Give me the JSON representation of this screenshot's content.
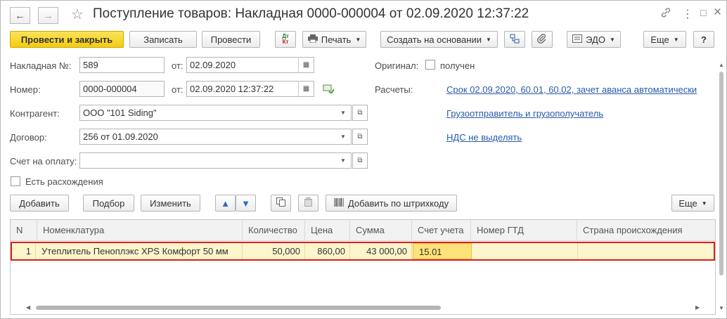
{
  "window": {
    "title": "Поступление товаров: Накладная 0000-000004 от 02.09.2020 12:37:22",
    "nav_back": "←",
    "nav_forward": "→",
    "star": "☆",
    "link_icon": "🔗",
    "menu_icon": "⋮",
    "max_icon": "□",
    "close_icon": "×"
  },
  "toolbar": {
    "post_and_close": "Провести и закрыть",
    "save": "Записать",
    "post": "Провести",
    "dtkt_dt": "Дт",
    "dtkt_kt": "Кт",
    "print": "Печать",
    "create_based_on": "Создать на основании",
    "edo": "ЭДО",
    "more": "Еще",
    "help": "?"
  },
  "form": {
    "invoice_no_label": "Накладная №:",
    "invoice_no_value": "589",
    "from_label": "от:",
    "invoice_date": "02.09.2020",
    "number_label": "Номер:",
    "number_value": "0000-000004",
    "number_date": "02.09.2020 12:37:22",
    "counterparty_label": "Контрагент:",
    "counterparty_value": "ООО \"101 Siding\"",
    "contract_label": "Договор:",
    "contract_value": "256 от 01.09.2020",
    "payment_account_label": "Счет на оплату:",
    "payment_account_value": "",
    "discrepancies_label": "Есть расхождения",
    "original_label": "Оригинал:",
    "received_label": "получен",
    "settlements_label": "Расчеты:",
    "settlements_link": "Срок 02.09.2020, 60.01, 60.02, зачет аванса автоматически",
    "shipper_link": "Грузоотправитель и грузополучатель",
    "vat_link": "НДС не выделять"
  },
  "table_toolbar": {
    "add": "Добавить",
    "pick": "Подбор",
    "change": "Изменить",
    "add_by_barcode": "Добавить по штрихкоду",
    "more": "Еще"
  },
  "table": {
    "columns": [
      "N",
      "Номенклатура",
      "Количество",
      "Цена",
      "Сумма",
      "Счет учета",
      "Номер ГТД",
      "Страна происхождения"
    ],
    "rows": [
      {
        "n": "1",
        "item": "Утеплитель Пеноплэкс XPS Комфорт 50 мм",
        "qty": "50,000",
        "price": "860,00",
        "sum": "43 000,00",
        "account": "15.01",
        "gtd": "",
        "country": ""
      }
    ]
  }
}
